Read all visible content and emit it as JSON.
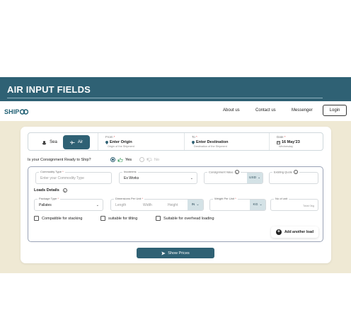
{
  "banner": {
    "title": "AIR INPUT FIELDS"
  },
  "navbar": {
    "logo": "SHIP",
    "links": [
      "About us",
      "Contact us",
      "Messenger"
    ],
    "login": "Login"
  },
  "modes": {
    "sea": "Sea",
    "air": "Air",
    "active": "Air"
  },
  "route": {
    "from": {
      "label": "From",
      "value": "Enter Origin",
      "sub": "Origin of the Shipment"
    },
    "to": {
      "label": "To",
      "value": "Enter Destination",
      "sub": "Destination of the Shipment"
    },
    "date": {
      "label": "Date",
      "value": "16 May'23",
      "sub": "Wednesday"
    },
    "required_mark": "*"
  },
  "ready": {
    "question": "Is your Consignment Ready to Ship?",
    "yes": "Yes",
    "no": "No",
    "selected": "Yes"
  },
  "commodity": {
    "label": "Commodity Type",
    "placeholder": "Enter your Commodity Type"
  },
  "incoterms": {
    "label": "Incoterms",
    "value": "Ex Works"
  },
  "consignment": {
    "label": "Consignment Value",
    "currency": "USD"
  },
  "existing_quote": {
    "label": "Existing Quote"
  },
  "loads": {
    "title": "Loads Details",
    "package_type": {
      "label": "Package Type",
      "value": "Pallates"
    },
    "dimensions": {
      "label": "Dimensions Per Unit",
      "length": "Length",
      "width": "Width",
      "height": "Height",
      "unit": "IN"
    },
    "weight": {
      "label": "Weight Per Unit",
      "unit": "KG"
    },
    "units": {
      "label": "No of unit",
      "total": "Total 0kg"
    },
    "options": [
      "Compatible for stacking",
      "suitable for tilting",
      "Suitable for overhead loading"
    ],
    "add_button": "Add another load"
  },
  "show_prices": "Show Prices",
  "colors": {
    "brand": "#2f6174",
    "background_band": "#efe9d4",
    "unit_chip": "#d4e2e6"
  }
}
